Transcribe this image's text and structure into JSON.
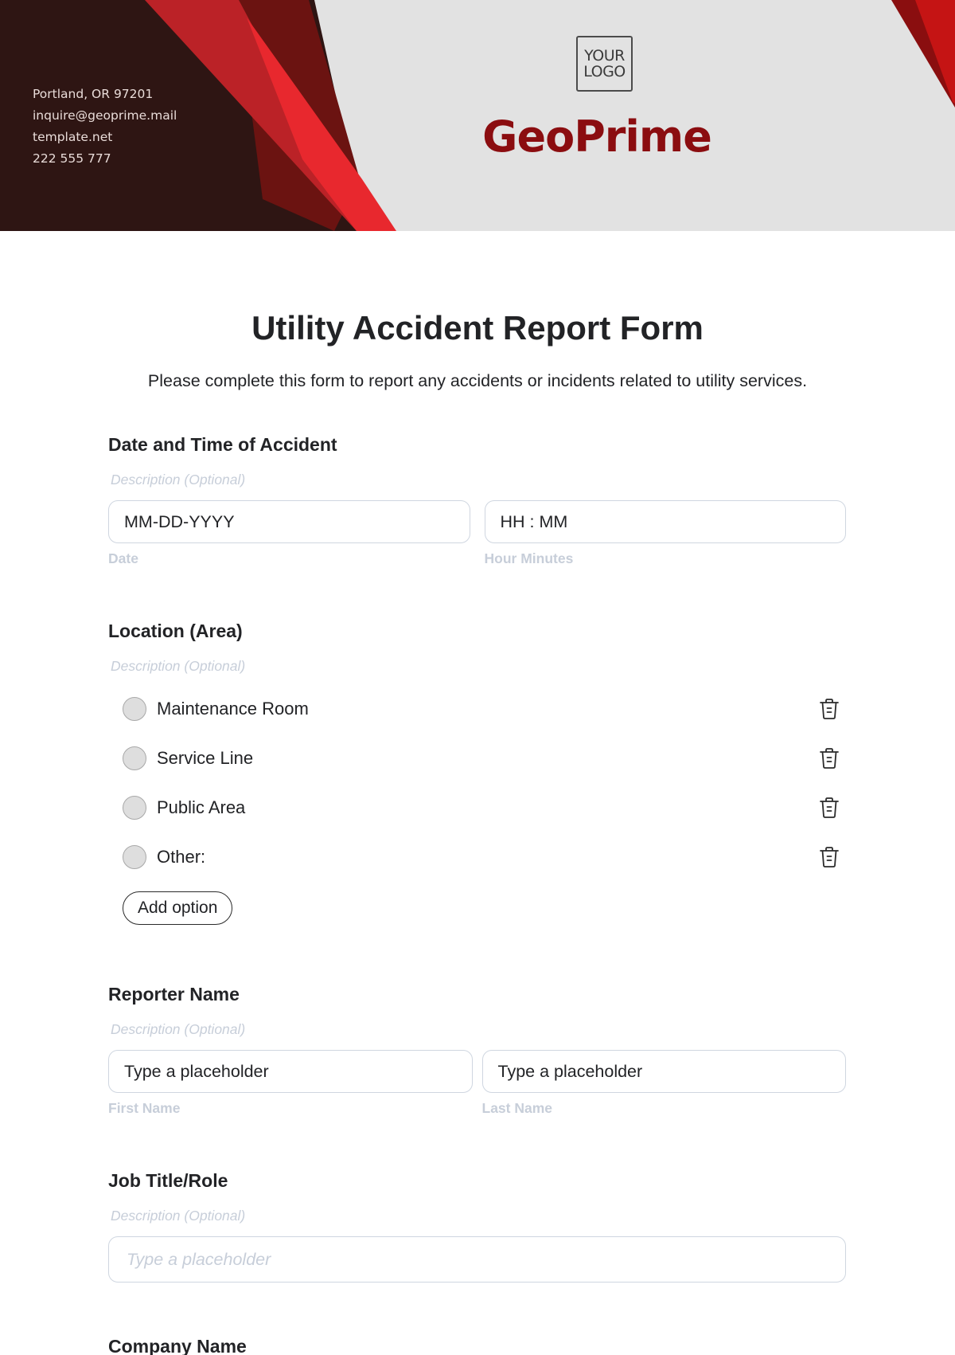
{
  "header": {
    "contact": {
      "address": "Portland, OR 97201",
      "email": "inquire@geoprime.mail",
      "website": "template.net",
      "phone": "222 555 777"
    },
    "logo": {
      "line1": "YOUR",
      "line2": "LOGO"
    },
    "brand_name": "GeoPrime",
    "colors": {
      "dark_brown": "#2e1513",
      "red": "#bb2227",
      "bright_red": "#e8282e",
      "dark_red": "#6b1311",
      "brand_text": "#8b0d10",
      "band_bg": "#e2e2e2"
    }
  },
  "form": {
    "title": "Utility Accident Report Form",
    "subtitle": "Please complete this form to report any accidents or incidents related to utility services.",
    "sections": [
      {
        "title": "Date and Time of Accident",
        "description": "Description (Optional)",
        "inputs": [
          {
            "value": "MM-DD-YYYY",
            "label": "Date"
          },
          {
            "value": "HH : MM",
            "label": "Hour Minutes"
          }
        ]
      },
      {
        "title": "Location (Area)",
        "description": "Description (Optional)",
        "options": [
          "Maintenance Room",
          "Service Line",
          "Public Area",
          "Other:"
        ],
        "add_option_label": "Add option"
      },
      {
        "title": "Reporter Name",
        "description": "Description (Optional)",
        "inputs": [
          {
            "value": "Type a placeholder",
            "label": "First Name"
          },
          {
            "value": "Type a placeholder",
            "label": "Last Name"
          }
        ]
      },
      {
        "title": "Job Title/Role",
        "description": "Description (Optional)",
        "placeholder": "Type a placeholder"
      },
      {
        "title": "Company Name"
      }
    ]
  }
}
